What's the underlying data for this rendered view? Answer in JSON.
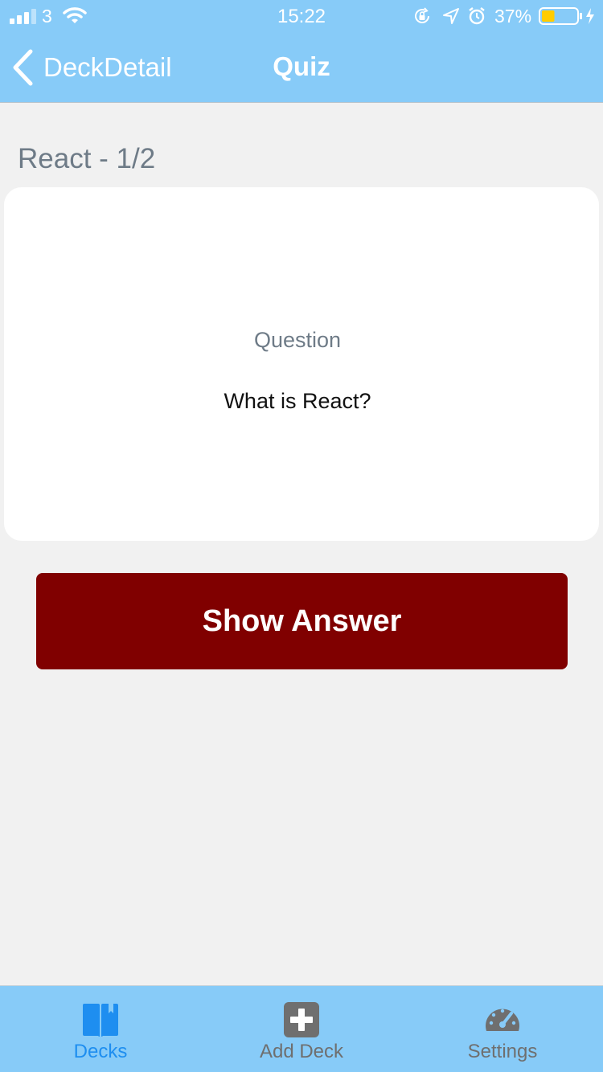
{
  "status_bar": {
    "carrier": "3",
    "time": "15:22",
    "battery_percent": "37%",
    "battery_level": 0.37,
    "icons": [
      "signal-icon",
      "wifi-icon",
      "rotation-lock-icon",
      "location-icon",
      "alarm-icon",
      "battery-icon",
      "charging-icon"
    ]
  },
  "nav": {
    "back_label": "DeckDetail",
    "title": "Quiz"
  },
  "quiz": {
    "heading": "React - 1/2",
    "card_label": "Question",
    "question": "What is React?",
    "show_answer_label": "Show Answer"
  },
  "tabs": [
    {
      "label": "Decks",
      "icon": "book-icon",
      "active": true
    },
    {
      "label": "Add Deck",
      "icon": "plus-square-icon",
      "active": false
    },
    {
      "label": "Settings",
      "icon": "speedometer-icon",
      "active": false
    }
  ],
  "colors": {
    "header_bg": "#87cbf8",
    "tabbar_bg": "#87cbf8",
    "page_bg": "#f1f1f1",
    "button_bg": "#800000",
    "active_tab": "#1e8ef0",
    "inactive_tab": "#6f6f6f",
    "muted_text": "#6e7b87"
  }
}
